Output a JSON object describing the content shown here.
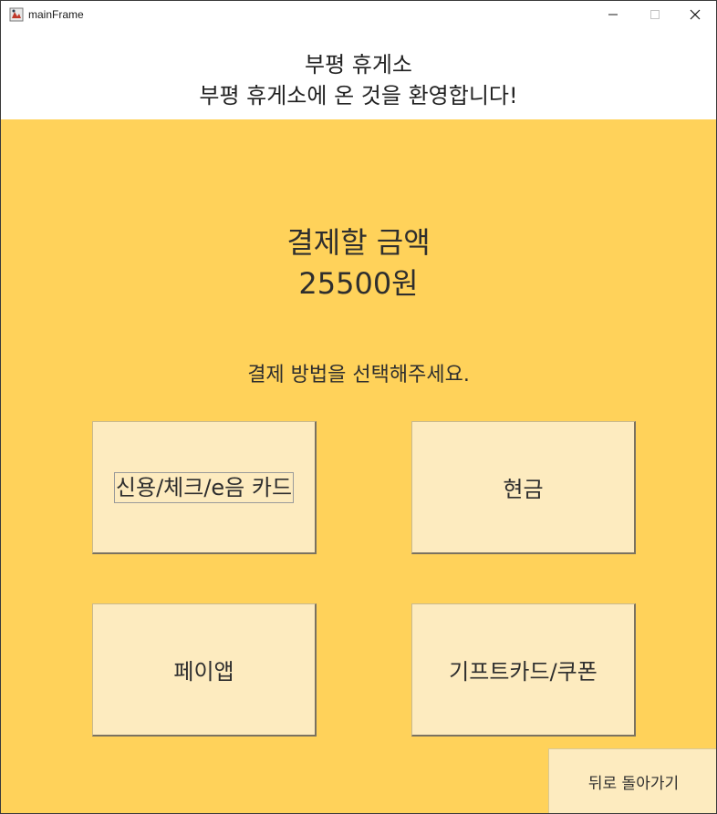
{
  "window": {
    "title": "mainFrame",
    "controls": {
      "minimize": "—",
      "maximize": "☐",
      "close": "✕"
    }
  },
  "header": {
    "line1": "부평 휴게소",
    "line2": "부평 휴게소에 온 것을 환영합니다!"
  },
  "payment": {
    "amount_label": "결제할 금액",
    "amount_value": "25500원",
    "method_prompt": "결제 방법을 선택해주세요.",
    "options": [
      {
        "label": "신용/체크/e음 카드"
      },
      {
        "label": "현금"
      },
      {
        "label": "페이앱"
      },
      {
        "label": "기프트카드/쿠폰"
      }
    ]
  },
  "back_label": "뒤로 돌아가기",
  "colors": {
    "panel_bg": "#ffd25a",
    "button_bg": "#fdebbf",
    "header_bg": "#ffffff"
  }
}
